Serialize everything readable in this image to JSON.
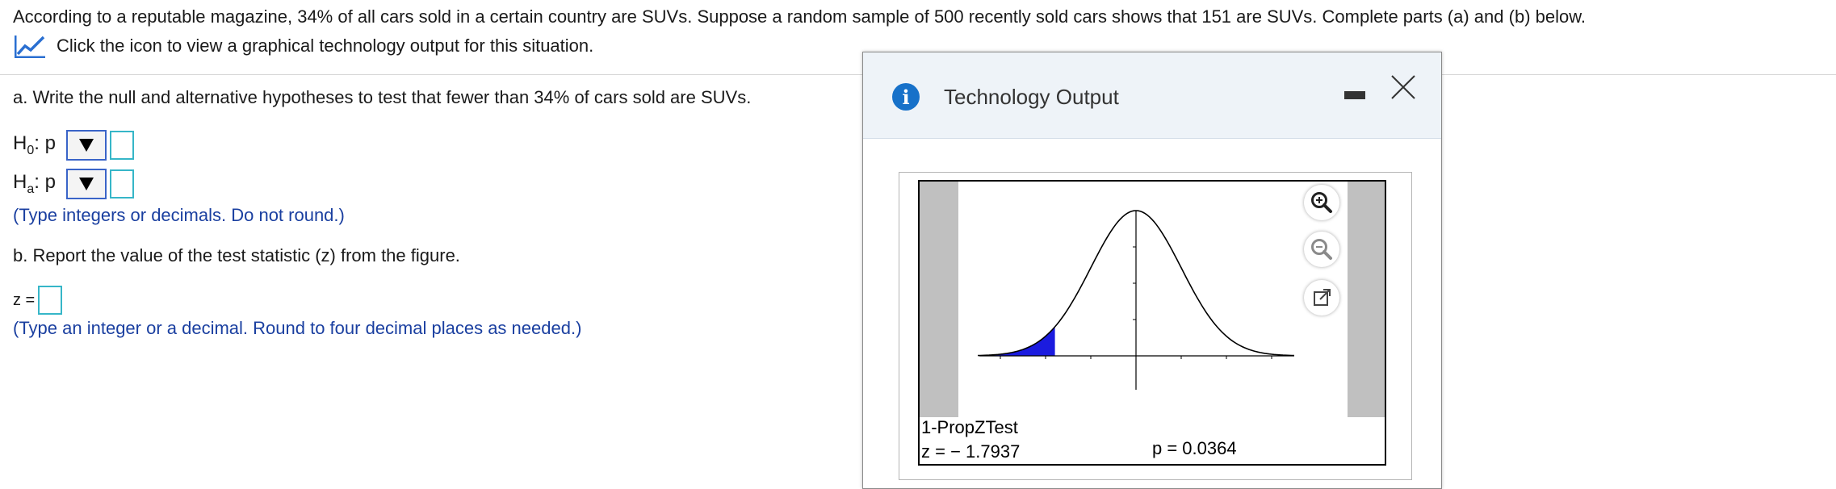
{
  "question": {
    "prompt": "According to a reputable magazine, 34% of all cars sold in a certain country are SUVs. Suppose a random sample of 500 recently sold cars shows that 151 are SUVs. Complete parts (a) and (b) below.",
    "icon_link": "Click the icon to view a graphical technology output for this situation."
  },
  "part_a": {
    "text": "a. Write the null and alternative hypotheses to test that fewer than 34% of cars sold are SUVs.",
    "h0_letter": "H",
    "h0_sub": "0",
    "h0_suffix": ": p",
    "ha_letter": "H",
    "ha_sub": "a",
    "ha_suffix": ": p",
    "note": "(Type integers or decimals. Do not round.)"
  },
  "part_b": {
    "text": "b. Report the value of the test statistic (z) from the figure.",
    "z_label": "z =",
    "note": "(Type an integer or a decimal. Round to four decimal places as needed.)"
  },
  "panel": {
    "title": "Technology Output",
    "info_glyph": "i",
    "test_name": "1-PropZTest",
    "z_text": "z = − 1.7937",
    "p_text": "p = 0.0364"
  },
  "colors": {
    "accent_blue": "#1a3fa0",
    "shaded_tail": "#1b1bdf",
    "info_icon": "#1771c9"
  }
}
